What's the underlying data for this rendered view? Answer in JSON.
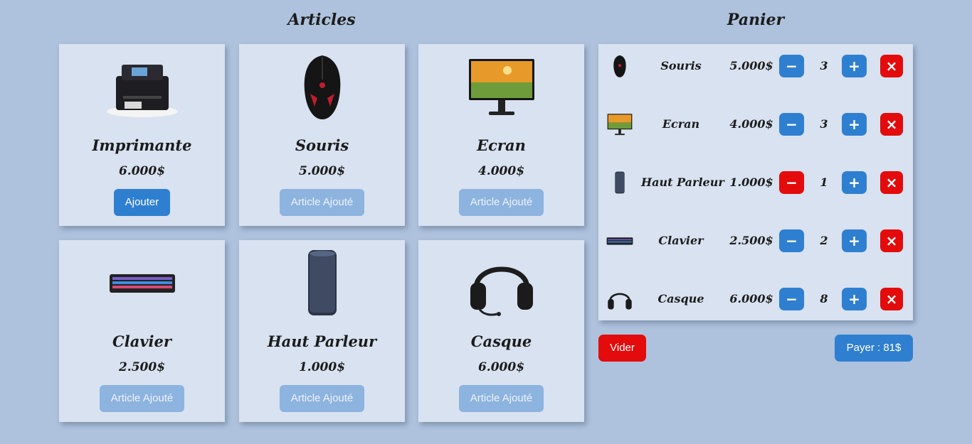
{
  "articles_title": "Articles",
  "cart_title": "Panier",
  "articles": [
    {
      "name": "Imprimante",
      "price": "6.000$",
      "button": "Ajouter",
      "state": "add",
      "icon": "printer-image"
    },
    {
      "name": "Souris",
      "price": "5.000$",
      "button": "Article Ajouté",
      "state": "added",
      "icon": "mouse-image"
    },
    {
      "name": "Ecran",
      "price": "4.000$",
      "button": "Article Ajouté",
      "state": "added",
      "icon": "monitor-image"
    },
    {
      "name": "Clavier",
      "price": "2.500$",
      "button": "Article Ajouté",
      "state": "added",
      "icon": "keyboard-image"
    },
    {
      "name": "Haut Parleur",
      "price": "1.000$",
      "button": "Article Ajouté",
      "state": "added",
      "icon": "speaker-image"
    },
    {
      "name": "Casque",
      "price": "6.000$",
      "button": "Article Ajouté",
      "state": "added",
      "icon": "headset-image"
    }
  ],
  "cart": [
    {
      "name": "Souris",
      "price": "5.000$",
      "qty": "3",
      "minus_color": "#2f7fd1"
    },
    {
      "name": "Ecran",
      "price": "4.000$",
      "qty": "3",
      "minus_color": "#2f7fd1"
    },
    {
      "name": "Haut Parleur",
      "price": "1.000$",
      "qty": "1",
      "minus_color": "#e30b0b"
    },
    {
      "name": "Clavier",
      "price": "2.500$",
      "qty": "2",
      "minus_color": "#2f7fd1"
    },
    {
      "name": "Casque",
      "price": "6.000$",
      "qty": "8",
      "minus_color": "#2f7fd1"
    }
  ],
  "cart_icons": {
    "minus": "−",
    "plus": "+",
    "remove": "×"
  },
  "actions": {
    "clear_label": "Vider",
    "pay_label": "Payer : 81$"
  },
  "colors": {
    "background": "#aec2dd",
    "card": "#d8e2f0",
    "primary": "#2f7fd1",
    "primary_disabled": "#8db3df",
    "danger": "#e30b0b"
  }
}
